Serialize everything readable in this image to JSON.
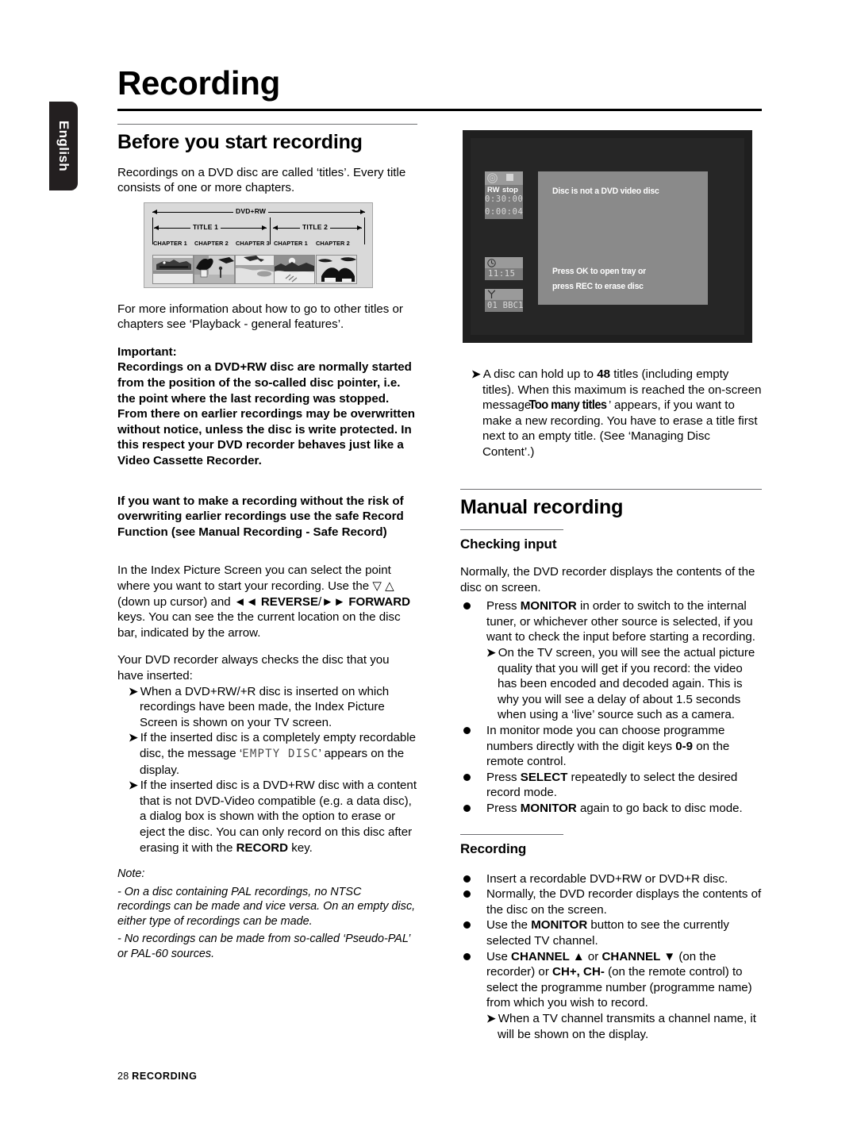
{
  "document": {
    "page_title": "Recording",
    "language_tab": "English",
    "footer_page_number": "28",
    "footer_section": "RECORDING"
  },
  "left_column": {
    "section_heading": "Before you start recording",
    "intro": "Recordings on a DVD disc are called ‘titles’. Every title consists of one or more chapters.",
    "after_diagram": "For more information about how to go to other titles or chapters see ‘Playback - general features’.",
    "important_label": "Important:",
    "important_body": "Recordings on a DVD+RW disc are normally started from the position of the so-called disc pointer, i.e. the point where the last recording was stopped. From there on earlier recordings may be overwritten without notice, unless the disc is write protected. In this respect your DVD recorder behaves just like a Video Cassette Recorder.",
    "safe_record": "If you want to make a recording without the risk of overwriting earlier recordings use the safe Record Function (see Manual Recording - Safe Record)",
    "index_screen_1": "In the Index Picture Screen you can select the point where you want to start your recording. Use the ",
    "index_screen_cursor": "▽ △",
    "index_screen_2": " (down up cursor) and ",
    "reverse_key": "◄◄ REVERSE",
    "slash": "/",
    "forward_key": "►► FORWARD",
    "index_screen_3": " keys. You can see the the current location on the disc bar, indicated by the arrow.",
    "checks_disc": "Your DVD recorder always checks the disc that you have inserted:",
    "check_items": [
      {
        "text_before": "When a DVD+RW/+R disc is inserted on which recordings have been made, the Index Picture Screen is shown on your TV screen.",
        "lcd": "",
        "text_after": ""
      },
      {
        "text_before": "If the inserted disc is a completely empty recordable disc, the message ‘",
        "lcd": "EMPTY DISC",
        "text_after": "’ appears on the display."
      },
      {
        "text_before": "If the inserted disc is a DVD+RW disc with a content that is not DVD-Video compatible (e.g. a data disc), a dialog box is shown with the option to erase or eject the disc. You can only record on this disc after erasing it with the ",
        "lcd": "",
        "text_after": " key.",
        "bold_key": "RECORD"
      }
    ],
    "note_label": "Note:",
    "note_1": "- On a disc containing PAL recordings, no NTSC recordings can be made and vice versa. On an empty disc, either type of recordings can be made.",
    "note_2": "- No recordings can be made from so-called ‘Pseudo-PAL’ or PAL-60 sources."
  },
  "diagram": {
    "disc_label": "DVD+RW",
    "titles": [
      "TITLE 1",
      "TITLE 2"
    ],
    "chapters_title1": [
      "CHAPTER 1",
      "CHAPTER 2",
      "CHAPTER 3"
    ],
    "chapters_title2": [
      "CHAPTER 1",
      "CHAPTER 2"
    ]
  },
  "tv_screen": {
    "disc_icon_caption": "RW",
    "stop_icon_caption": "stop",
    "remaining_time": "0:30:00",
    "elapsed_time": "0:00:04",
    "clock_time": "11:15",
    "channel": "01 BBC1",
    "message_line_1": "Disc is not a DVD video disc",
    "message_line_2": "Press OK to open tray or",
    "message_line_3": "press REC to erase disc"
  },
  "right_column": {
    "max_titles_before": "A disc can hold up to ",
    "max_titles_count": "48",
    "max_titles_mid": " titles (including empty titles). When this maximum is reached the on-screen message ‘",
    "max_titles_osd": "Too many titles",
    "max_titles_after": "’ appears, if you want to make a new recording. You have to erase a title first next to an empty title. (See ‘Managing Disc Content’.)",
    "manual_recording_heading": "Manual recording",
    "checking_input_heading": "Checking input",
    "checking_input_intro": "Normally, the DVD recorder displays the contents of the disc on screen.",
    "checking_bullets": [
      {
        "pre": "Press ",
        "key": "MONITOR",
        "post": " in order to switch to the internal tuner, or whichever other source is selected, if you want to check the input before starting a recording.",
        "sub": "On the TV screen, you will see the actual picture quality that you will get if you record: the video has been encoded and decoded again. This is why you will see a delay of about 1.5 seconds when using a ‘live’ source such as a camera."
      },
      {
        "pre": "In monitor mode you can choose programme numbers directly with the digit keys ",
        "key": "0-9",
        "post": " on the remote control.",
        "sub": ""
      },
      {
        "pre": "Press ",
        "key": "SELECT",
        "post": " repeatedly to select the desired record mode.",
        "sub": ""
      },
      {
        "pre": "Press ",
        "key": "MONITOR",
        "post": " again to go back to disc mode.",
        "sub": ""
      }
    ],
    "recording_heading": "Recording",
    "recording_bullets": [
      {
        "pre": "Insert a recordable DVD+RW or DVD+R disc.",
        "key": "",
        "post": "",
        "sub": ""
      },
      {
        "pre": "Normally, the DVD recorder displays the contents of the disc on the screen.",
        "key": "",
        "post": "",
        "sub": ""
      },
      {
        "pre": "Use the ",
        "key": "MONITOR",
        "post": " button to see the currently selected TV channel.",
        "sub": ""
      },
      {
        "pre": "Use ",
        "key": "CHANNEL ▲",
        "mid": " or ",
        "key2": "CHANNEL ▼",
        "post": " (on the recorder) or ",
        "key3": "CH+, CH-",
        "post2": " (on the remote control) to select the programme number (programme name) from which you wish to record.",
        "sub": "When a TV channel transmits a channel name, it will be shown on the display."
      }
    ]
  },
  "colors": {
    "page_background": "#ffffff",
    "text": "#000000",
    "tab_background": "#231f20",
    "rule_grey": "#6d6e71",
    "diagram_background": "#d9d9d9",
    "tv_background": "#1f1f1f",
    "tv_inner": "#262626",
    "osd_panel": "#8a8a8a",
    "status_panel": "#7c7c7c"
  }
}
